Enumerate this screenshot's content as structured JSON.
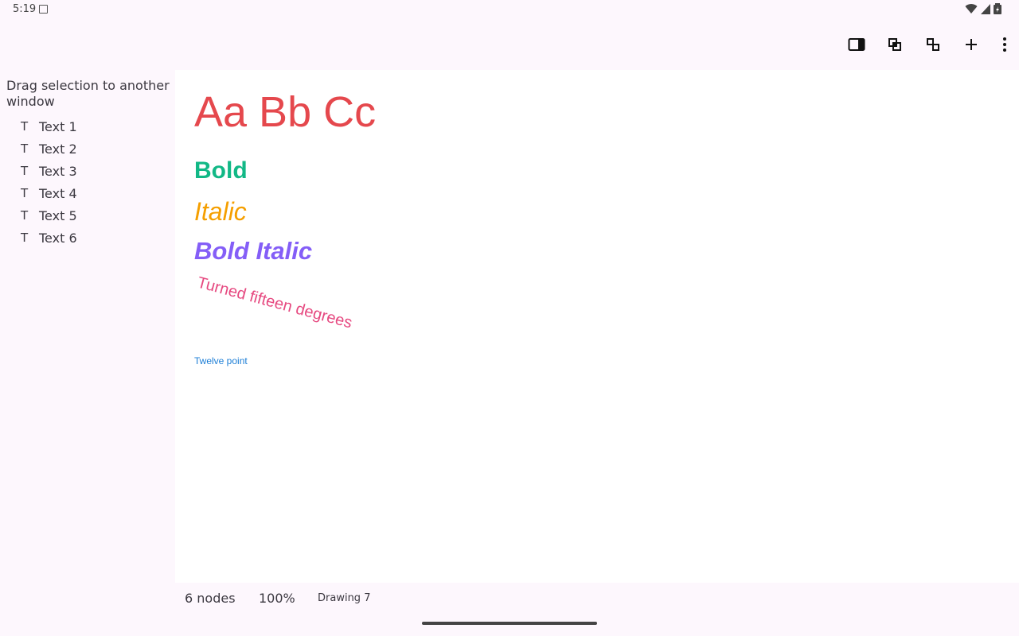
{
  "status_bar": {
    "time": "5:19",
    "icons": [
      "notification-icon",
      "wifi-icon",
      "signal-icon",
      "battery-icon"
    ]
  },
  "toolbar": {
    "buttons": [
      "panel-toggle-icon",
      "group-icon",
      "ungroup-icon",
      "add-icon",
      "more-vert-icon"
    ]
  },
  "sidebar": {
    "header": "Drag selection to another window",
    "icon_glyph": "T",
    "items": [
      {
        "label": "Text 1"
      },
      {
        "label": "Text 2"
      },
      {
        "label": "Text 3"
      },
      {
        "label": "Text 4"
      },
      {
        "label": "Text 5"
      },
      {
        "label": "Text 6"
      }
    ]
  },
  "canvas": {
    "texts": [
      {
        "text": "Aa Bb Cc",
        "color": "#e5484d"
      },
      {
        "text": "Bold",
        "color": "#12b886"
      },
      {
        "text": "Italic",
        "color": "#f59f00"
      },
      {
        "text": "Bold Italic",
        "color": "#845ef7"
      },
      {
        "text": "Turned fifteen degrees",
        "color": "#e64980",
        "rotation_deg": 15
      },
      {
        "text": "Twelve point",
        "color": "#1c7ed6"
      }
    ]
  },
  "footer": {
    "nodes": "6 nodes",
    "zoom": "100%",
    "drawing_name": "Drawing 7"
  }
}
